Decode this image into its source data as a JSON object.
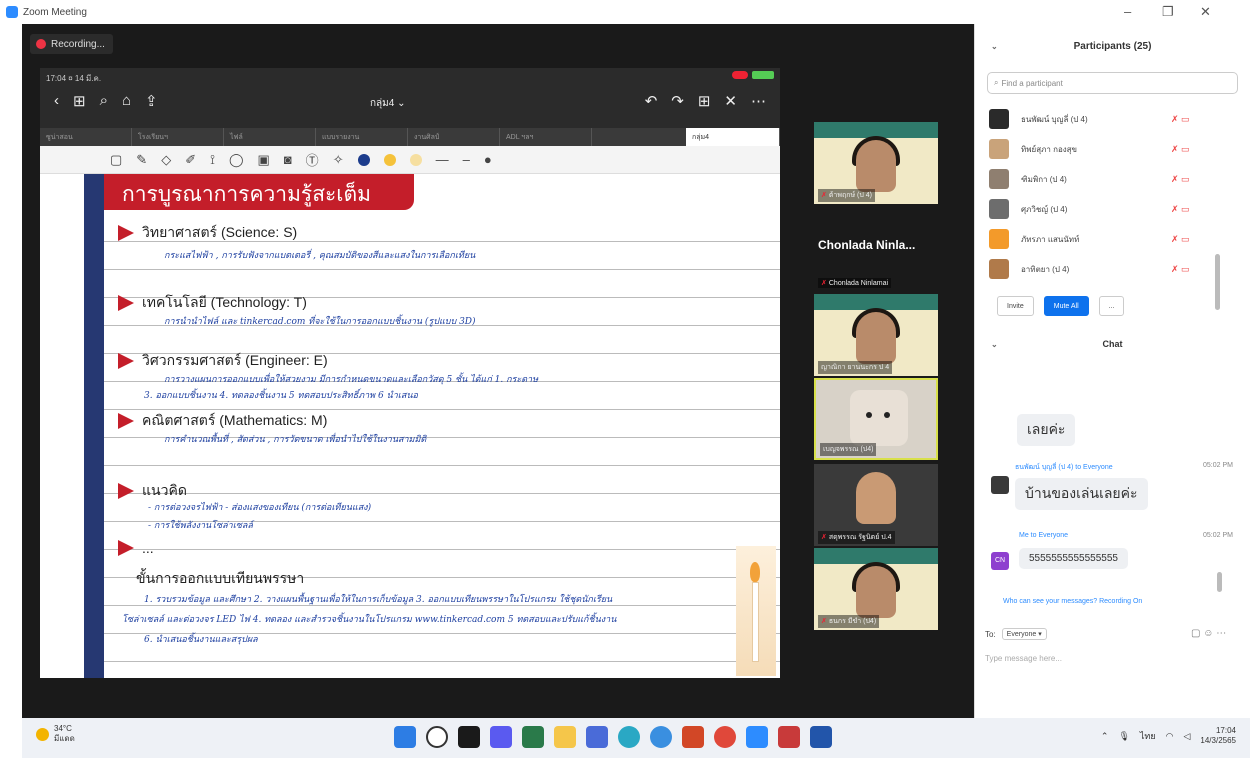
{
  "window": {
    "title": "Zoom Meeting",
    "controls": [
      "–",
      "❐",
      "✕"
    ]
  },
  "recording": {
    "label": "Recording..."
  },
  "ipad": {
    "status": "17:04  ¤ 14 มี.ค.",
    "doc_title": "กลุ่ม4 ⌄",
    "tabs": [
      "ซูน่าสอน",
      "โรงเรียนฯ",
      "ไฟล์",
      "แบบรายงาน",
      "งานศิลป์",
      "ADL ฯลฯ",
      "กลุ่ม4"
    ],
    "nav_icons": [
      "‹",
      "⊞",
      "⌕",
      "⌂",
      "⇪"
    ],
    "right_icons": [
      "↶",
      "↷",
      "⊞",
      "✕",
      "⋯"
    ]
  },
  "slide": {
    "banner": "การบูรณาการความรู้สะเต็ม",
    "sections": [
      {
        "label": "วิทยาศาสตร์ (Science: S)"
      },
      {
        "label": "เทคโนโลยี (Technology: T)"
      },
      {
        "label": "วิศวกรรมศาสตร์ (Engineer: E)"
      },
      {
        "label": "คณิตศาสตร์ (Mathematics: M)"
      },
      {
        "label": "แนวคิด"
      },
      {
        "label": "..."
      }
    ],
    "steps_label": "ขั้นการออกแบบเทียนพรรษา",
    "handwriting": [
      "กระแสไฟฟ้า , การรับฟังจากแบตเตอรี่ , คุณสมบัติของสีและแสงในการเลือกเทียน",
      "การนำนำไฟล์ และ tinkercad.com ที่จะใช้ในการออกแบบชิ้นงาน (รูปแบบ 3D)",
      "การวางแผนการออกแบบเพื่อให้สวยงาม มีการกำหนดขนาดและเลือกวัสดุ 5 ชั้น ได้แก่ 1. กระดาษ",
      "3. ออกแบบชิ้นงาน 4. ทดลองชิ้นงาน 5 ทดสอบประสิทธิ์ภาพ 6 นำเสนอ",
      "การคำนวณพื้นที่ , สัดส่วน , การวัดขนาด เพื่อนำไปใช้ในงานสามมิติ",
      "- การต่อวงจรไฟฟ้า          - ส่องแสงของเทียน (การต่อเทียนแสง)",
      "- การใช้พลังงานโซล่าเซลล์",
      "1. รวบรวมข้อมูล และศึกษา 2. วางแผนพื้นฐานเพื่อให้ในการเก็บข้อมูล 3. ออกแบบเทียนพรรษาในโปรแกรม ใช้ชุดนักเรียน",
      "โซล่าเซลล์ และต่อวงจร LED ไฟ   4. ทดลอง และสำรวจชิ้นงานในโปรแกรม www.tinkercad.com 5 ทดสอบและปรับแก้ชิ้นงาน",
      "6. นำเสนอชิ้นงานและสรุปผล"
    ]
  },
  "filmstrip": [
    {
      "name": "ต้าพฤกษ์ (ป 4)",
      "kind": "girl"
    },
    {
      "name": "Chonlada Ninlamai",
      "big": "Chonlada Ninla...",
      "kind": "text"
    },
    {
      "name": "ญาณิกา ยานนะกร ป 4",
      "kind": "girl"
    },
    {
      "name": "เบญจพรรณ (ป4)",
      "kind": "dog"
    },
    {
      "name": "สดุพรรณ รัฐนิตย์ ป.4",
      "kind": "boy"
    },
    {
      "name": "ธนกร มีขำ (ป4)",
      "kind": "girl"
    }
  ],
  "panel": {
    "participants_title": "Participants (25)",
    "search_placeholder": "Find a participant",
    "participants": [
      {
        "name": "ธนพัฒน์ บุญลี่ (ป 4)",
        "color": "#2a2a2a"
      },
      {
        "name": "ทิพย์สุภา กองสุข",
        "color": "#c9a37a"
      },
      {
        "name": "ฑิมพิกา (ป 4)",
        "color": "#8f7f70"
      },
      {
        "name": "ศุภวิชญ์ (ป 4)",
        "color": "#6d6d6d"
      },
      {
        "name": "ภัทรภา แสนนัทท์",
        "color": "#f39a2a"
      },
      {
        "name": "อาทิตยา (ป 4)",
        "color": "#b07a4a"
      }
    ],
    "invite_label": "Invite",
    "mute_all_label": "Mute All",
    "more_label": "...",
    "chat_title": "Chat",
    "messages": [
      {
        "text": "เลยค่ะ"
      },
      {
        "sender": "ธนพัฒน์ บุญลี่ (ป 4) to Everyone",
        "time": "05:02 PM",
        "text": "บ้านของเล่นเลยค่ะ"
      },
      {
        "sender": "Me to Everyone",
        "time": "05:02 PM",
        "text": "5555555555555555",
        "initials": "CN"
      }
    ],
    "info": "Who can see your messages? Recording On",
    "to_label": "To:",
    "to_value": "Everyone ▾",
    "type_placeholder": "Type message here..."
  },
  "taskbar": {
    "temp": "34°C",
    "weather": "มีแดด",
    "lang": "ไทย",
    "time": "17:04",
    "date": "14/3/2565"
  }
}
